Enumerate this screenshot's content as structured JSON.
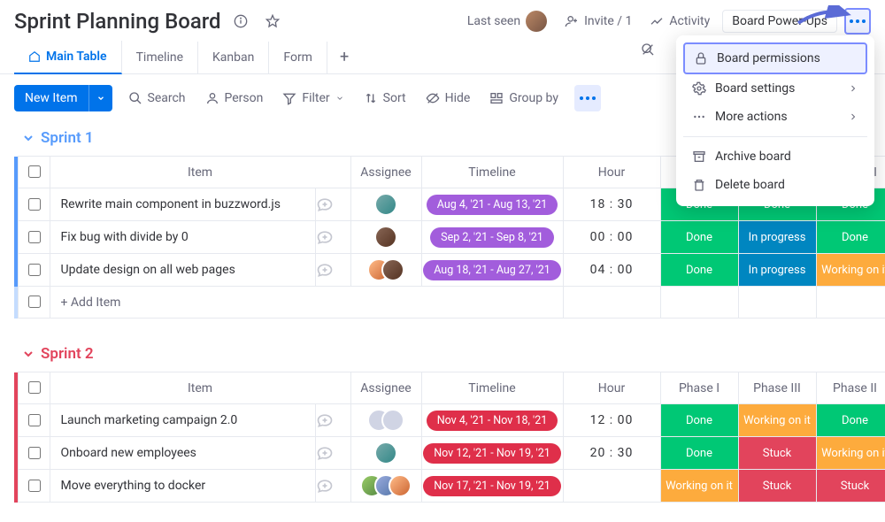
{
  "header": {
    "title": "Sprint Planning Board",
    "last_seen": "Last seen",
    "invite": "Invite / 1",
    "activity": "Activity",
    "powerups": "Board Power-Ups"
  },
  "tabs": {
    "main": "Main Table",
    "timeline": "Timeline",
    "kanban": "Kanban",
    "form": "Form"
  },
  "toolbar": {
    "new_item": "New Item",
    "search": "Search",
    "person": "Person",
    "filter": "Filter",
    "sort": "Sort",
    "hide": "Hide",
    "group_by": "Group by"
  },
  "menu": {
    "permissions": "Board permissions",
    "settings": "Board settings",
    "more": "More actions",
    "archive": "Archive board",
    "delete": "Delete board"
  },
  "columns": {
    "item": "Item",
    "assignee": "Assignee",
    "timeline": "Timeline",
    "hour": "Hour",
    "phase1": "Phase I",
    "phase3": "Phase III",
    "phase2": "Phase II"
  },
  "status": {
    "done": "Done",
    "in_progress": "In progress",
    "working": "Working on it",
    "stuck": "Stuck"
  },
  "groups": [
    {
      "name": "Sprint 1",
      "add_item": "+ Add Item",
      "rows": [
        {
          "item": "Rewrite main component in buzzword.js",
          "timeline": "Aug 4, '21 - Aug 13, '21",
          "pill": "purple",
          "hour": "18 : 30",
          "assignees": [
            "av1"
          ],
          "phases": [
            "done",
            "done",
            "done"
          ]
        },
        {
          "item": "Fix bug with divide by 0",
          "timeline": "Sep 2, '21 - Sep 8, '21",
          "pill": "purple",
          "hour": "00 : 00",
          "assignees": [
            "av2"
          ],
          "phases": [
            "done",
            "in_progress",
            "done"
          ]
        },
        {
          "item": "Update design on all web pages",
          "timeline": "Aug 18, '21 - Aug 27, '21",
          "pill": "purple",
          "hour": "04 : 00",
          "assignees": [
            "av3",
            "av2"
          ],
          "phases": [
            "done",
            "in_progress",
            "working"
          ]
        }
      ]
    },
    {
      "name": "Sprint 2",
      "rows": [
        {
          "item": "Launch marketing campaign 2.0",
          "timeline": "Nov 4, '21 - Nov 18, '21",
          "pill": "red",
          "hour": "12 : 00",
          "assignees": [
            "av4",
            "av4"
          ],
          "phases": [
            "done",
            "working",
            "done"
          ]
        },
        {
          "item": "Onboard new employees",
          "timeline": "Nov 12, '21 - Nov 19, '21",
          "pill": "red",
          "hour": "20 : 30",
          "assignees": [
            "av1"
          ],
          "phases": [
            "done",
            "stuck",
            "working"
          ]
        },
        {
          "item": "Move everything to docker",
          "timeline": "Nov 17, '21 - Nov 19, '21",
          "pill": "red",
          "hour": "",
          "assignees": [
            "av5",
            "av6",
            "av3"
          ],
          "phases": [
            "working",
            "stuck",
            "stuck"
          ]
        }
      ]
    }
  ]
}
